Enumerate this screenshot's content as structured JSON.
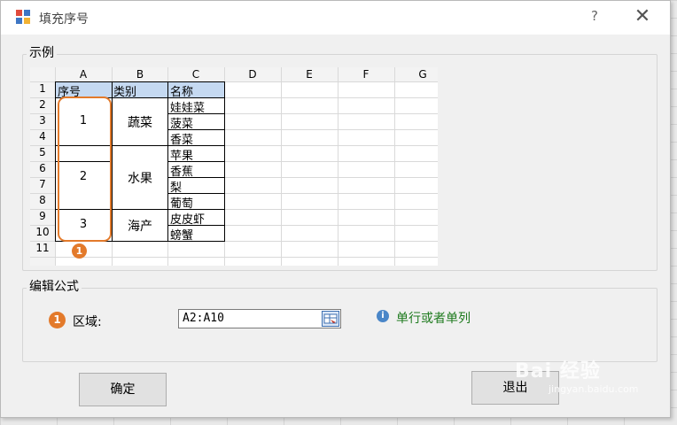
{
  "window": {
    "title": "填充序号",
    "help": "?",
    "close": "✕"
  },
  "example": {
    "label": "示例",
    "columns": [
      "A",
      "B",
      "C",
      "D",
      "E",
      "F",
      "G"
    ],
    "rows": [
      "1",
      "2",
      "3",
      "4",
      "5",
      "6",
      "7",
      "8",
      "9",
      "10",
      "11"
    ],
    "header": {
      "a": "序号",
      "b": "类别",
      "c": "名称"
    },
    "groups": [
      {
        "seq": "1",
        "category": "蔬菜"
      },
      {
        "seq": "2",
        "category": "水果"
      },
      {
        "seq": "3",
        "category": "海产"
      }
    ],
    "names": [
      "娃娃菜",
      "菠菜",
      "香菜",
      "苹果",
      "香蕉",
      "梨",
      "葡萄",
      "皮皮虾",
      "螃蟹"
    ],
    "badge": "1"
  },
  "formula": {
    "label": "编辑公式",
    "badge": "1",
    "range_label": "区域:",
    "range_value": "A2:A10",
    "hint": "单行或者单列"
  },
  "buttons": {
    "ok": "确定",
    "exit": "退出"
  },
  "watermark": {
    "brand": "Bai 经验",
    "url": "jingyan.baidu.com"
  },
  "colors": {
    "accent": "#e37a2b",
    "hint": "#1e7a1e",
    "header_highlight": "#c5d9f1"
  }
}
